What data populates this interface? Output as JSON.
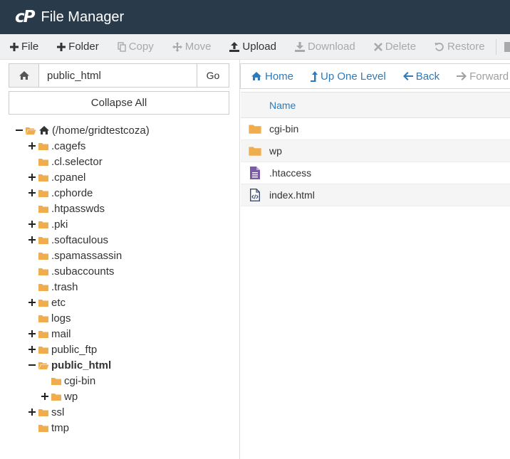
{
  "app": {
    "logo": "cP",
    "title": "File Manager"
  },
  "toolbar": [
    {
      "label": "File",
      "icon": "plus-icon",
      "enabled": true
    },
    {
      "label": "Folder",
      "icon": "plus-icon",
      "enabled": true
    },
    {
      "label": "Copy",
      "icon": "copy-icon",
      "enabled": false
    },
    {
      "label": "Move",
      "icon": "move-icon",
      "enabled": false
    },
    {
      "label": "Upload",
      "icon": "upload-icon",
      "enabled": true
    },
    {
      "label": "Download",
      "icon": "download-icon",
      "enabled": false
    },
    {
      "label": "Delete",
      "icon": "delete-icon",
      "enabled": false
    },
    {
      "label": "Restore",
      "icon": "restore-icon",
      "enabled": false
    }
  ],
  "path_bar": {
    "value": "public_html",
    "go_label": "Go"
  },
  "collapse_label": "Collapse All",
  "tree": [
    {
      "label": "(/home/gridtestcoza)",
      "level": 0,
      "toggle": "minus",
      "open": true,
      "home": true
    },
    {
      "label": ".cagefs",
      "level": 1,
      "toggle": "plus"
    },
    {
      "label": ".cl.selector",
      "level": 1,
      "toggle": ""
    },
    {
      "label": ".cpanel",
      "level": 1,
      "toggle": "plus"
    },
    {
      "label": ".cphorde",
      "level": 1,
      "toggle": "plus"
    },
    {
      "label": ".htpasswds",
      "level": 1,
      "toggle": ""
    },
    {
      "label": ".pki",
      "level": 1,
      "toggle": "plus"
    },
    {
      "label": ".softaculous",
      "level": 1,
      "toggle": "plus"
    },
    {
      "label": ".spamassassin",
      "level": 1,
      "toggle": ""
    },
    {
      "label": ".subaccounts",
      "level": 1,
      "toggle": ""
    },
    {
      "label": ".trash",
      "level": 1,
      "toggle": ""
    },
    {
      "label": "etc",
      "level": 1,
      "toggle": "plus"
    },
    {
      "label": "logs",
      "level": 1,
      "toggle": ""
    },
    {
      "label": "mail",
      "level": 1,
      "toggle": "plus"
    },
    {
      "label": "public_ftp",
      "level": 1,
      "toggle": "plus"
    },
    {
      "label": "public_html",
      "level": 1,
      "toggle": "minus",
      "open": true,
      "bold": true
    },
    {
      "label": "cgi-bin",
      "level": 2,
      "toggle": ""
    },
    {
      "label": "wp",
      "level": 2,
      "toggle": "plus"
    },
    {
      "label": "ssl",
      "level": 1,
      "toggle": "plus"
    },
    {
      "label": "tmp",
      "level": 1,
      "toggle": ""
    }
  ],
  "nav": [
    {
      "label": "Home",
      "icon": "home-icon",
      "enabled": true
    },
    {
      "label": "Up One Level",
      "icon": "level-up-icon",
      "enabled": true
    },
    {
      "label": "Back",
      "icon": "arrow-left-icon",
      "enabled": true
    },
    {
      "label": "Forward",
      "icon": "arrow-right-icon",
      "enabled": false
    }
  ],
  "list": {
    "column": "Name",
    "rows": [
      {
        "name": "cgi-bin",
        "type": "folder"
      },
      {
        "name": "wp",
        "type": "folder"
      },
      {
        "name": ".htaccess",
        "type": "text"
      },
      {
        "name": "index.html",
        "type": "html"
      }
    ]
  },
  "colors": {
    "header": "#293a4a",
    "folder": "#f0ad4e",
    "link": "#2f7ab8",
    "text_file": "#7b5aa6",
    "html_file": "#3a4b6c"
  }
}
